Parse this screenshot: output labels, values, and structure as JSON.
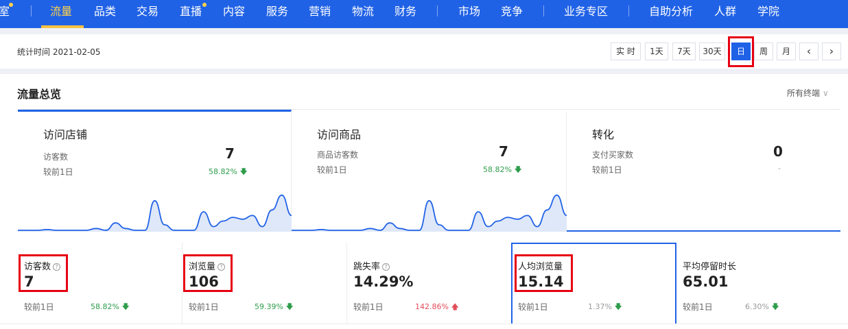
{
  "nav": {
    "items": [
      {
        "label": "室"
      },
      {
        "label": "流量"
      },
      {
        "label": "品类"
      },
      {
        "label": "交易"
      },
      {
        "label": "直播"
      },
      {
        "label": "内容"
      },
      {
        "label": "服务"
      },
      {
        "label": "营销"
      },
      {
        "label": "物流"
      },
      {
        "label": "财务"
      },
      {
        "label": "市场"
      },
      {
        "label": "竞争"
      },
      {
        "label": "业务专区"
      },
      {
        "label": "自助分析"
      },
      {
        "label": "人群"
      },
      {
        "label": "学院"
      }
    ],
    "active": "流量"
  },
  "datebar": {
    "stat_time": "统计时间 2021-02-05",
    "periods": [
      "实 时",
      "1天",
      "7天",
      "30天",
      "日",
      "周",
      "月"
    ],
    "active_period": "日",
    "prev_icon": "‹",
    "next_icon": "›"
  },
  "overview": {
    "title": "流量总览",
    "terminal": "所有终端",
    "cards": [
      {
        "title": "访问店铺",
        "metric": "访客数",
        "value": "7",
        "compare": "较前1日",
        "change": "58.82%",
        "direction": "down",
        "spark": [
          0,
          0,
          0,
          0.02,
          0,
          0,
          0,
          0,
          0.05,
          0,
          0.2,
          0.05,
          0,
          0,
          0.8,
          0.15,
          0,
          0,
          0,
          0.5,
          0.1,
          0.25,
          0.35,
          0.3,
          0.4,
          0.1,
          0.55,
          0.95,
          0.4
        ]
      },
      {
        "title": "访问商品",
        "metric": "商品访客数",
        "value": "7",
        "compare": "较前1日",
        "change": "58.82%",
        "direction": "down",
        "spark": [
          0,
          0,
          0,
          0.02,
          0,
          0,
          0,
          0,
          0.05,
          0,
          0.2,
          0.05,
          0,
          0,
          0.8,
          0.15,
          0,
          0,
          0,
          0.5,
          0.1,
          0.25,
          0.35,
          0.3,
          0.4,
          0.1,
          0.55,
          0.95,
          0.4
        ]
      },
      {
        "title": "转化",
        "metric": "支付买家数",
        "value": "0",
        "compare": "较前1日",
        "change": "-",
        "direction": "none",
        "spark": []
      }
    ]
  },
  "tiles": [
    {
      "name": "访客数",
      "help": true,
      "value": "7",
      "compare": "较前1日",
      "change": "58.82%",
      "direction": "down"
    },
    {
      "name": "浏览量",
      "help": true,
      "value": "106",
      "compare": "较前1日",
      "change": "59.39%",
      "direction": "down"
    },
    {
      "name": "跳失率",
      "help": true,
      "value": "14.29%",
      "compare": "较前1日",
      "change": "142.86%",
      "direction": "up"
    },
    {
      "name": "人均浏览量",
      "help": false,
      "value": "15.14",
      "compare": "较前1日",
      "change": "1.37%",
      "direction": "down"
    },
    {
      "name": "平均停留时长",
      "help": false,
      "value": "65.01",
      "compare": "较前1日",
      "change": "6.30%",
      "direction": "down"
    }
  ],
  "colors": {
    "accent": "#2062e6",
    "highlight": "#e60012",
    "down": "#2e9d4b",
    "up": "#e34d59",
    "spark_fill": "#dfe8f8"
  }
}
